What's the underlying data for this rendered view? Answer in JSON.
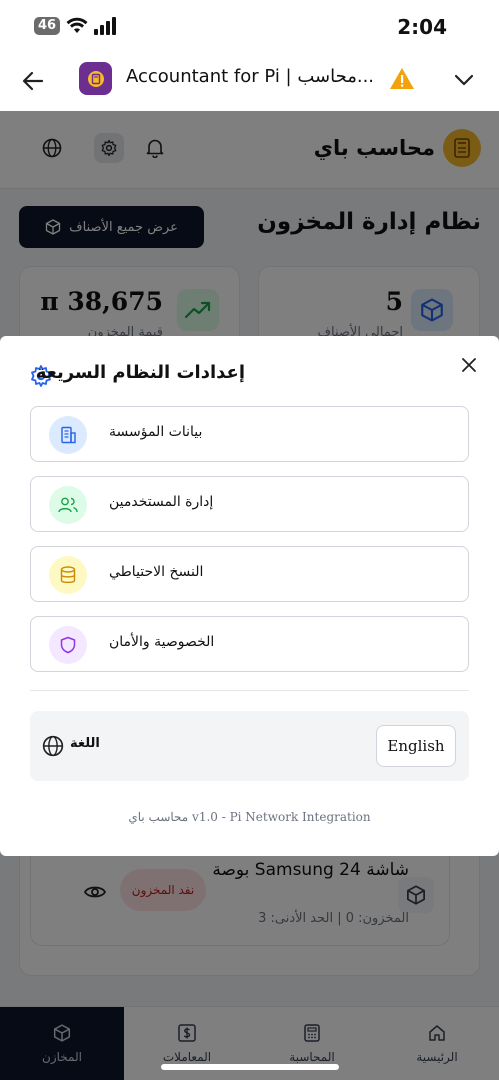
{
  "status_bar": {
    "network": "46",
    "time": "2:04"
  },
  "browser": {
    "title": "Accountant for Pi | محاسب...",
    "warning_icon": "warning-icon",
    "back_icon": "back-arrow-icon",
    "menu_icon": "chevron-down-icon"
  },
  "app": {
    "brand_name": "محاسب باي",
    "page_heading": "نظام إدارة المخزون",
    "view_all_label": "عرض جميع الأصناف",
    "stats": [
      {
        "value": "π 38,675",
        "label": "قيمة المخزون"
      },
      {
        "value": "5",
        "label": "إجمالي الأصناف"
      }
    ],
    "product": {
      "name": "شاشة Samsung 24 بوصة",
      "meta": "المخزون: 0 | الحد الأدنى: 3",
      "badge": "نفد المخزون"
    },
    "bottom_nav": [
      {
        "label": "المخازن",
        "icon": "package-icon",
        "active": true
      },
      {
        "label": "المعاملات",
        "icon": "dollar-icon",
        "active": false
      },
      {
        "label": "المحاسبة",
        "icon": "calculator-icon",
        "active": false
      },
      {
        "label": "الرئيسية",
        "icon": "home-icon",
        "active": false
      }
    ]
  },
  "modal": {
    "title": "إعدادات النظام السريعة",
    "items": [
      {
        "label": "بيانات المؤسسة",
        "icon": "building-icon",
        "color": "#2563eb",
        "bg": "#dbeafe"
      },
      {
        "label": "إدارة المستخدمين",
        "icon": "users-icon",
        "color": "#16a34a",
        "bg": "#dcfce7"
      },
      {
        "label": "النسخ الاحتياطي",
        "icon": "database-icon",
        "color": "#ca8a04",
        "bg": "#fef9c3"
      },
      {
        "label": "الخصوصية والأمان",
        "icon": "shield-icon",
        "color": "#9333ea",
        "bg": "#f3e8ff"
      }
    ],
    "language": {
      "label": "اللغة",
      "button": "English"
    },
    "footer": "محاسب باي v1.0 - Pi Network Integration"
  },
  "colors": {
    "accent_dark": "#0f172a",
    "brand_gold": "#f6b928",
    "settings_gear": "#2563eb"
  }
}
